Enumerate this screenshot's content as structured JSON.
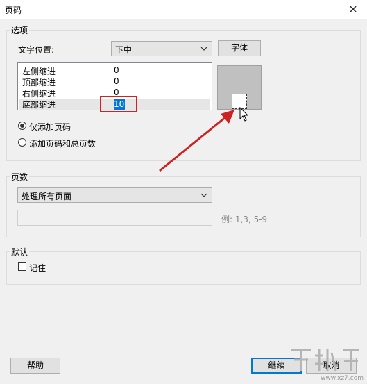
{
  "window": {
    "title": "页码",
    "close_glyph": "✕"
  },
  "options": {
    "legend": "选项",
    "text_position_label": "文字位置:",
    "text_position_value": "下中",
    "font_button": "字体",
    "margins": [
      {
        "label": "左侧缩进",
        "value": "0"
      },
      {
        "label": "顶部缩进",
        "value": "0"
      },
      {
        "label": "右侧缩进",
        "value": "0"
      },
      {
        "label": "底部缩进",
        "value": "10"
      }
    ],
    "radio_page_only": "仅添加页码",
    "radio_page_total": "添加页码和总页数"
  },
  "pages": {
    "legend": "页数",
    "range_value": "处理所有页面",
    "range_input": "",
    "example_hint": "例: 1,3, 5-9"
  },
  "defaults": {
    "legend": "默认",
    "remember_label": "记住"
  },
  "footer": {
    "help": "帮助",
    "continue": "继续",
    "cancel": "取消"
  },
  "watermark": {
    "text": "www.xz7.com"
  },
  "colors": {
    "highlight_box": "#d42020",
    "arrow": "#cc2222",
    "selection": "#0078d7"
  }
}
